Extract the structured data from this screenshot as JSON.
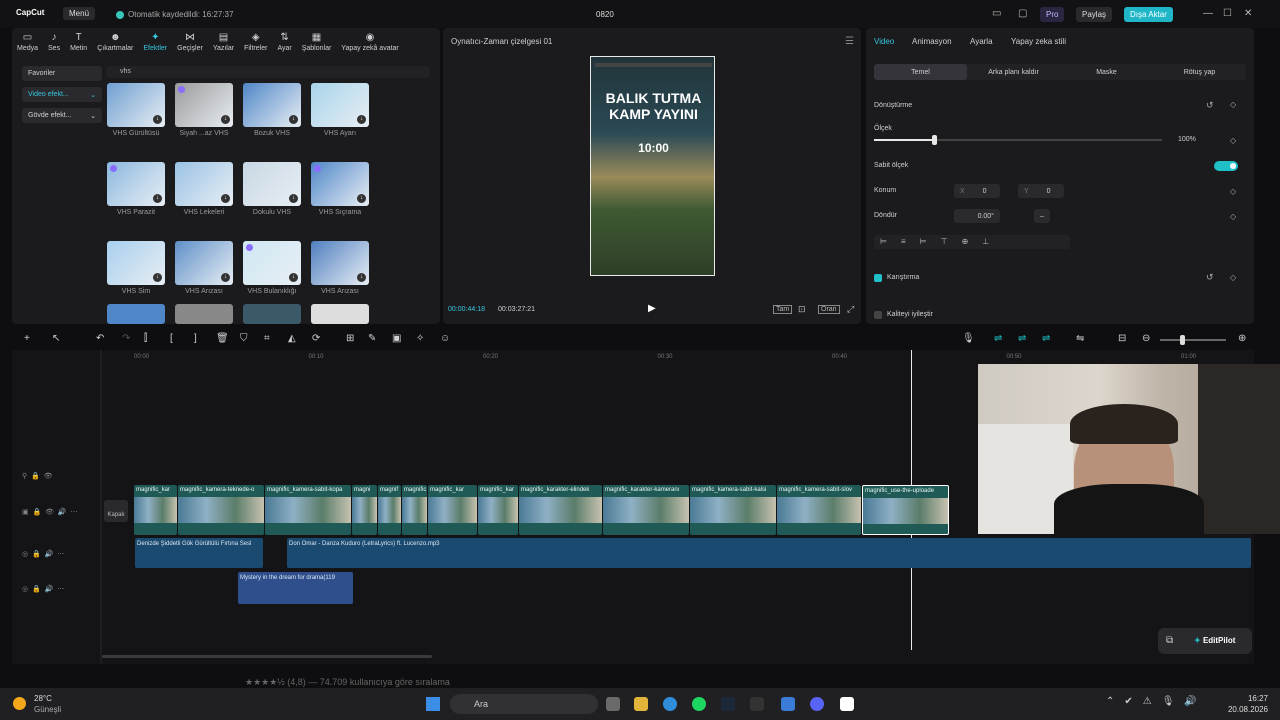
{
  "app": {
    "logo": "CapCut",
    "menu": "Menü",
    "autosave": "Otomatik kaydedildi: 16:27:37",
    "project": "0820",
    "pro": "Pro",
    "share": "Paylaş",
    "export": "Dışa Aktar"
  },
  "toolbar": [
    "Medya",
    "Ses",
    "Metin",
    "Çıkartmalar",
    "Efektler",
    "Geçişler",
    "Yazılar",
    "Filtreler",
    "Ayar",
    "Şablonlar",
    "Yapay zekâ avatar"
  ],
  "categories": [
    "Favoriler",
    "Video efekt...",
    "Gövde efekt..."
  ],
  "search": {
    "value": "vhs"
  },
  "effects": [
    {
      "label": "VHS Gürültüsü",
      "color": "#6f9fd0"
    },
    {
      "label": "Siyah ...az VHS",
      "color": "#9a9a9a"
    },
    {
      "label": "Bozuk VHS",
      "color": "#4f86c7"
    },
    {
      "label": "VHS Ayarı",
      "color": "#a8d4ea"
    },
    {
      "label": "VHS Parazit",
      "color": "#8cb8de"
    },
    {
      "label": "VHS Lekeleri",
      "color": "#9ac2e4"
    },
    {
      "label": "Dokulu VHS",
      "color": "#c8d8e4"
    },
    {
      "label": "VHS Sıçrama",
      "color": "#4f86c7"
    },
    {
      "label": "VHS Sim",
      "color": "#a8cfee"
    },
    {
      "label": "VHS Arızası",
      "color": "#5f90c8"
    },
    {
      "label": "VHS Bulanıklığı",
      "color": "#cfe8f4"
    },
    {
      "label": "VHS Arızası",
      "color": "#4f7fc0"
    }
  ],
  "player": {
    "title": "Oynatıcı-Zaman çizelgesi 01",
    "current": "00:00:44:18",
    "total": "00:03:27:21",
    "preview_title1": "BALIK TUTMA",
    "preview_title2": "KAMP YAYINI",
    "preview_time": "10:00",
    "btn_full": "Tam",
    "btn_ratio": "Oran"
  },
  "inspector": {
    "tabs": [
      "Video",
      "Animasyon",
      "Ayarla",
      "Yapay zeka stili"
    ],
    "subtabs": [
      "Temel",
      "Arka planı kaldır",
      "Maske",
      "Rötuş yap"
    ],
    "transform": "Dönüştürme",
    "scale": "Ölçek",
    "scale_val": "100%",
    "uniform": "Sabit ölçek",
    "position": "Konum",
    "pos_x_lbl": "X",
    "pos_x": "0",
    "pos_y_lbl": "Y",
    "pos_y": "0",
    "rotate": "Döndür",
    "rotate_val": "0.00°",
    "blend": "Karıştırma",
    "quality": "Kaliteyi iyileştir"
  },
  "timeline": {
    "ruler": [
      "00:00",
      "00:10",
      "00:20",
      "00:30",
      "00:40",
      "00:50",
      "01:00"
    ],
    "cover": "Kapak",
    "clips": [
      "magnific_kar",
      "magnific_kamera-teknede-o",
      "magnific_kamera-sabit-kopa",
      "magni",
      "magnif",
      "magnific",
      "magnific_kar",
      "magnific_kar",
      "magnific_karakter-elindek",
      "magnific_karakter-kameranı",
      "magnific_kamera-sabit-kalsi",
      "magnific_kamera-sabit-slov",
      "magnific_use-the-uploade"
    ],
    "audio1": "Denizde Şiddetli Gök Gürültülü Fırtına Sesl",
    "audio2": "Don Omar - Danza Kuduro (LetraLyrics) ft. Lucenzo.mp3",
    "audio3": "Mystery in the dream for drama(119"
  },
  "webpage_behind": "★★★★½ (4,8) — 74.709 kullanıcıya göre sıralama",
  "editpilot": "EditPilot",
  "taskbar": {
    "weather_temp": "28°C",
    "weather_desc": "Güneşli",
    "search": "Ara",
    "time": "16:27",
    "date": "20.08.2026"
  }
}
